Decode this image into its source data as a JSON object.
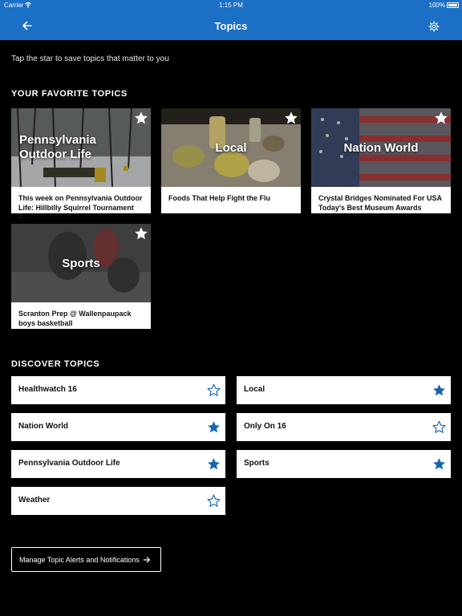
{
  "status_bar": {
    "carrier": "Carrier",
    "time": "1:15 PM",
    "battery": "100%",
    "wifi_icon": "wifi-icon"
  },
  "nav": {
    "title": "Topics",
    "back_icon": "arrow-left-icon",
    "settings_icon": "gear-icon"
  },
  "subtitle": "Tap the star to save topics that matter to you",
  "favorites": {
    "heading": "YOUR FAVORITE TOPICS",
    "cards": [
      {
        "topic": "Pennsylvania Outdoor Life",
        "headline": "This week on Pennsylvania Outdoor Life:  Hillbilly Squirrel Tournament &...",
        "starred": true
      },
      {
        "topic": "Local",
        "headline": "Foods That Help Fight the Flu",
        "starred": true
      },
      {
        "topic": "Nation World",
        "headline": "Crystal Bridges Nominated For USA Today's Best Museum Awards",
        "starred": true
      },
      {
        "topic": "Sports",
        "headline": "Scranton Prep @ Wallenpaupack boys basketball",
        "starred": true
      }
    ]
  },
  "discover": {
    "heading": "DISCOVER TOPICS",
    "items": [
      {
        "label": "Healthwatch 16",
        "starred": false
      },
      {
        "label": "Local",
        "starred": true
      },
      {
        "label": "Nation World",
        "starred": true
      },
      {
        "label": "Only On 16",
        "starred": false
      },
      {
        "label": "Pennsylvania Outdoor Life",
        "starred": true
      },
      {
        "label": "Sports",
        "starred": true
      },
      {
        "label": "Weather",
        "starred": false
      }
    ]
  },
  "manage_button": {
    "label": "Manage Topic Alerts and Notifications",
    "icon": "arrow-right-icon"
  },
  "colors": {
    "brand_blue": "#1b6fc4",
    "star_blue": "#1565b5",
    "background": "#000000"
  }
}
